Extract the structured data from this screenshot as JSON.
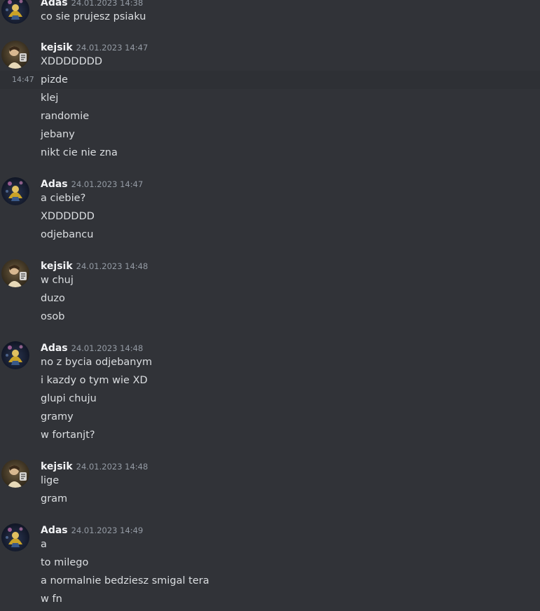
{
  "messages": [
    {
      "author": "Adas",
      "timestamp": "24.01.2023 14:38",
      "avatar": "adas-avatar",
      "lines": [
        "co sie prujesz psiaku"
      ]
    },
    {
      "author": "kejsik",
      "timestamp": "24.01.2023 14:47",
      "avatar": "kejsik-avatar",
      "lines": [
        "XDDDDDDD",
        "pizde",
        "klej",
        "randomie",
        "jebany",
        "nikt cie nie zna"
      ],
      "hovered_line": {
        "index": 1,
        "time": "14:47"
      }
    },
    {
      "author": "Adas",
      "timestamp": "24.01.2023 14:47",
      "avatar": "adas-avatar",
      "lines": [
        "a ciebie?",
        "XDDDDDD",
        "odjebancu"
      ]
    },
    {
      "author": "kejsik",
      "timestamp": "24.01.2023 14:48",
      "avatar": "kejsik-avatar",
      "lines": [
        "w chuj",
        "duzo",
        "osob"
      ]
    },
    {
      "author": "Adas",
      "timestamp": "24.01.2023 14:48",
      "avatar": "adas-avatar",
      "lines": [
        "no z bycia odjebanym",
        "i kazdy o tym wie XD",
        "glupi chuju",
        "gramy",
        "w fortanjt?"
      ]
    },
    {
      "author": "kejsik",
      "timestamp": "24.01.2023 14:48",
      "avatar": "kejsik-avatar",
      "lines": [
        "lige",
        "gram"
      ]
    },
    {
      "author": "Adas",
      "timestamp": "24.01.2023 14:49",
      "avatar": "adas-avatar",
      "lines": [
        "a",
        "to milego",
        "a normalnie bedziesz smigal tera",
        "w fn"
      ]
    }
  ]
}
